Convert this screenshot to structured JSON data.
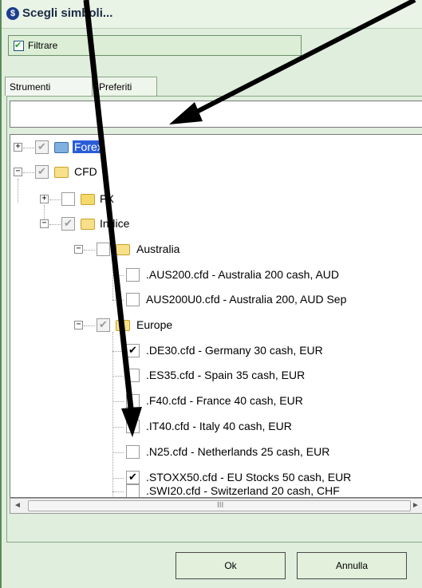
{
  "window": {
    "title": "Scegli simboli..."
  },
  "filter": {
    "label": "Filtrare",
    "checked": true
  },
  "tabs": [
    {
      "label": "Strumenti",
      "active": true
    },
    {
      "label": "Preferiti",
      "active": false
    }
  ],
  "search": {
    "value": "",
    "placeholder": ""
  },
  "tree": [
    {
      "label": "Forex",
      "checked": true,
      "grey": true,
      "expander": "+",
      "selected": true,
      "icon": "globe-folder-icon"
    },
    {
      "label": "CFD",
      "checked": true,
      "grey": true,
      "expander": "−",
      "icon": "folder-open-icon"
    },
    {
      "label": "FX",
      "checked": false,
      "grey": false,
      "expander": "+",
      "icon": "folder-icon"
    },
    {
      "label": "Indice",
      "checked": true,
      "grey": true,
      "expander": "−",
      "icon": "folder-open-icon"
    },
    {
      "label": "Australia",
      "checked": false,
      "grey": false,
      "expander": "−",
      "icon": "folder-open-icon"
    },
    {
      "label": ".AUS200.cfd - Australia 200 cash, AUD",
      "checked": false
    },
    {
      "label": "AUS200U0.cfd - Australia 200, AUD Sep",
      "checked": false
    },
    {
      "label": "Europe",
      "checked": true,
      "grey": true,
      "expander": "−",
      "icon": "folder-open-icon"
    },
    {
      "label": ".DE30.cfd - Germany 30 cash, EUR",
      "checked": true
    },
    {
      "label": ".ES35.cfd - Spain 35 cash, EUR",
      "checked": false
    },
    {
      "label": ".F40.cfd - France 40 cash, EUR",
      "checked": false
    },
    {
      "label": ".IT40.cfd - Italy 40 cash, EUR",
      "checked": true
    },
    {
      "label": ".N25.cfd - Netherlands 25 cash, EUR",
      "checked": false
    },
    {
      "label": ".STOXX50.cfd - EU Stocks 50 cash, EUR",
      "checked": true
    },
    {
      "label": ".SWI20.cfd - Switzerland 20 cash, CHF",
      "checked": false
    }
  ],
  "scrollbar": {
    "left": "◄",
    "grip": "III",
    "right": "►"
  },
  "buttons": {
    "ok": "Ok",
    "cancel": "Annulla"
  },
  "colors": {
    "accent": "#2a5cd8",
    "background": "#dfeedd",
    "check": "#21a121"
  }
}
